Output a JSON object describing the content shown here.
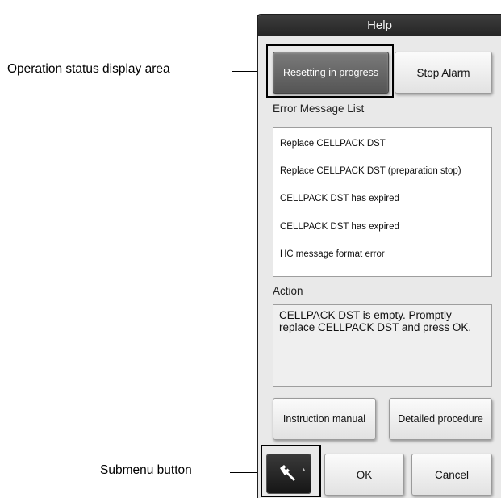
{
  "callouts": {
    "operation_status": "Operation status display area",
    "submenu": "Submenu button"
  },
  "dialog": {
    "title": "Help",
    "status_button": "Resetting in progress",
    "stop_alarm_button": "Stop Alarm",
    "error_list_label": "Error Message List",
    "error_messages": [
      "Replace CELLPACK DST",
      "Replace CELLPACK DST (preparation stop)",
      "CELLPACK DST has expired",
      "CELLPACK DST has expired",
      "HC message format error"
    ],
    "action_label": "Action",
    "action_text": "CELLPACK DST is empty. Promptly replace CELLPACK DST and press OK.",
    "instruction_manual_button": "Instruction manual",
    "detailed_procedure_button": "Detailed procedure",
    "submenu_icon": "wrench-icon",
    "ok_button": "OK",
    "cancel_button": "Cancel"
  },
  "colors": {
    "titlebar": "#262626",
    "window_bg": "#e9e9e9",
    "status_button_bg": "#5f5f5f",
    "submenu_button_bg": "#1f1f1f"
  }
}
